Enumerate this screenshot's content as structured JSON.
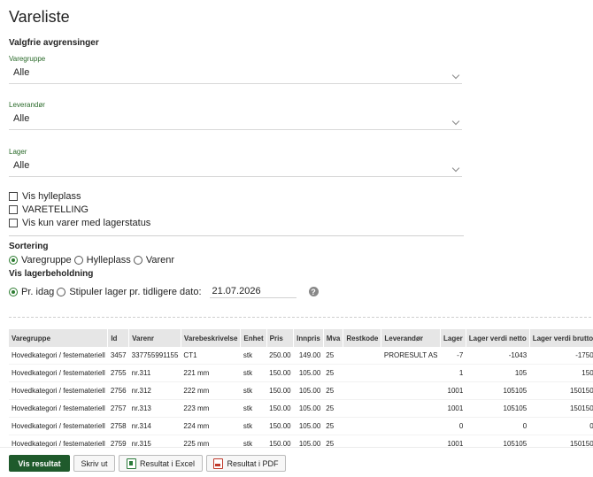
{
  "page": {
    "title": "Vareliste"
  },
  "filters": {
    "heading": "Valgfrie avgrensinger",
    "varegruppe": {
      "label": "Varegruppe",
      "value": "Alle"
    },
    "leverandor": {
      "label": "Leverandør",
      "value": "Alle"
    },
    "lager": {
      "label": "Lager",
      "value": "Alle"
    },
    "checkboxes": [
      "Vis hylleplass",
      "VARETELLING",
      "Vis kun varer med lagerstatus"
    ]
  },
  "sorting": {
    "heading": "Sortering",
    "options": [
      "Varegruppe",
      "Hylleplass",
      "Varenr"
    ],
    "selected": "Varegruppe"
  },
  "stock": {
    "heading": "Vis lagerbeholdning",
    "option_today": "Pr. idag",
    "option_date": "Stipuler lager pr. tidligere dato:",
    "date_value": "21.07.2026",
    "help": "?"
  },
  "table": {
    "headers": [
      "Varegruppe",
      "Id",
      "Varenr",
      "Varebeskrivelse",
      "Enhet",
      "Pris",
      "Innpris",
      "Mva",
      "Restkode",
      "Leverandør",
      "Lager",
      "Lager verdi netto",
      "Lager verdi brutto"
    ],
    "rows": [
      [
        "Hovedkategori / festemateriell",
        "3457",
        "337755991155",
        "CT1",
        "stk",
        "250.00",
        "149.00",
        "25",
        "",
        "PRORESULT AS",
        "-7",
        "-1043",
        "-1750"
      ],
      [
        "Hovedkategori / festemateriell",
        "2755",
        "nr.311",
        "221 mm",
        "stk",
        "150.00",
        "105.00",
        "25",
        "",
        "",
        "1",
        "105",
        "150"
      ],
      [
        "Hovedkategori / festemateriell",
        "2756",
        "nr.312",
        "222 mm",
        "stk",
        "150.00",
        "105.00",
        "25",
        "",
        "",
        "1001",
        "105105",
        "150150"
      ],
      [
        "Hovedkategori / festemateriell",
        "2757",
        "nr.313",
        "223 mm",
        "stk",
        "150.00",
        "105.00",
        "25",
        "",
        "",
        "1001",
        "105105",
        "150150"
      ],
      [
        "Hovedkategori / festemateriell",
        "2758",
        "nr.314",
        "224 mm",
        "stk",
        "150.00",
        "105.00",
        "25",
        "",
        "",
        "0",
        "0",
        "0"
      ],
      [
        "Hovedkategori / festemateriell",
        "2759",
        "nr.315",
        "225 mm",
        "stk",
        "150.00",
        "105.00",
        "25",
        "",
        "",
        "1001",
        "105105",
        "150150"
      ]
    ]
  },
  "actions": {
    "show": "Vis resultat",
    "print": "Skriv ut",
    "excel": "Resultat i Excel",
    "pdf": "Resultat i PDF"
  },
  "colors": {
    "accent": "#1f5a2c",
    "label_green": "#2a6a2a"
  }
}
